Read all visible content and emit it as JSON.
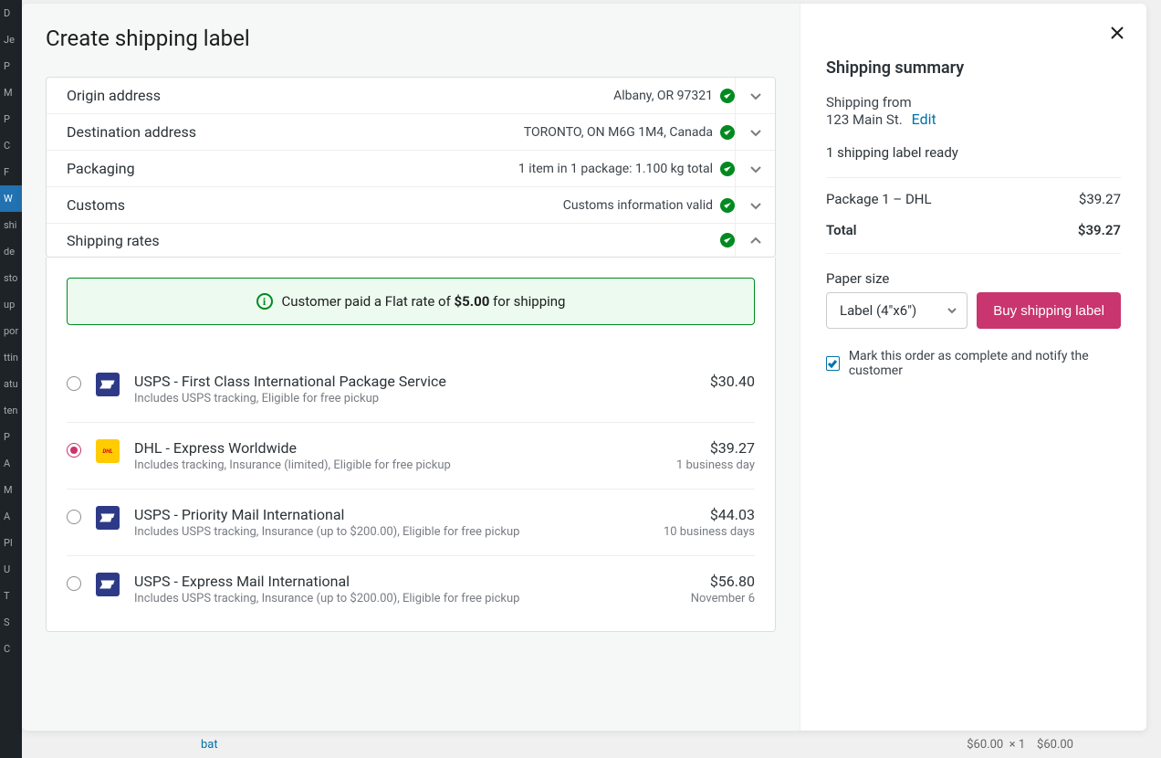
{
  "modal": {
    "title": "Create shipping label"
  },
  "sections": {
    "origin": {
      "label": "Origin address",
      "value": "Albany, OR  97321"
    },
    "destination": {
      "label": "Destination address",
      "value": "TORONTO, ON  M6G 1M4, Canada"
    },
    "packaging": {
      "label": "Packaging",
      "value": "1 item in 1 package: 1.100 kg total"
    },
    "customs": {
      "label": "Customs",
      "value": "Customs information valid"
    },
    "rates": {
      "label": "Shipping rates"
    }
  },
  "notice": {
    "prefix": "Customer paid a Flat rate of ",
    "amount": "$5.00",
    "suffix": " for shipping"
  },
  "rates": [
    {
      "carrier": "usps",
      "name": "USPS - First Class International Package Service",
      "desc": "Includes USPS tracking, Eligible for free pickup",
      "price": "$30.40",
      "eta": "",
      "selected": false
    },
    {
      "carrier": "dhl",
      "name": "DHL - Express Worldwide",
      "desc": "Includes tracking, Insurance (limited), Eligible for free pickup",
      "price": "$39.27",
      "eta": "1 business day",
      "selected": true
    },
    {
      "carrier": "usps",
      "name": "USPS - Priority Mail International",
      "desc": "Includes USPS tracking, Insurance (up to $200.00), Eligible for free pickup",
      "price": "$44.03",
      "eta": "10 business days",
      "selected": false
    },
    {
      "carrier": "usps",
      "name": "USPS - Express Mail International",
      "desc": "Includes USPS tracking, Insurance (up to $200.00), Eligible for free pickup",
      "price": "$56.80",
      "eta": "November 6",
      "selected": false
    }
  ],
  "summary": {
    "title": "Shipping summary",
    "from_label": "Shipping from",
    "from_address": "123 Main St.",
    "edit": "Edit",
    "ready": "1 shipping label ready",
    "line_label": "Package 1 – DHL",
    "line_amount": "$39.27",
    "total_label": "Total",
    "total_amount": "$39.27",
    "paper_label": "Paper size",
    "paper_value": "Label (4\"x6\")",
    "buy_label": "Buy shipping label",
    "mark_complete_label": "Mark this order as complete and notify the customer"
  },
  "bg": {
    "link": "bat",
    "price1": "$60.00",
    "qty": "× 1",
    "price2": "$60.00"
  }
}
